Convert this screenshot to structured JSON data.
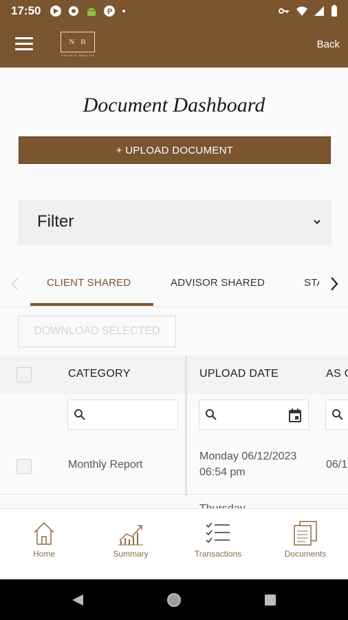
{
  "status_bar": {
    "time": "17:50"
  },
  "header": {
    "logo_letters": [
      "N",
      "B"
    ],
    "logo_subtext": "PRIVATE WEALTH",
    "back_label": "Back"
  },
  "page": {
    "title": "Document Dashboard",
    "upload_label": "+ UPLOAD DOCUMENT",
    "filter_label": "Filter"
  },
  "tabs": [
    {
      "label": "CLIENT SHARED",
      "active": true
    },
    {
      "label": "ADVISOR SHARED",
      "active": false
    },
    {
      "label": "STA",
      "active": false
    }
  ],
  "download_label": "DOWNLOAD SELECTED",
  "table": {
    "columns": [
      "CATEGORY",
      "UPLOAD DATE",
      "AS O"
    ],
    "rows": [
      {
        "category": "Monthly Report",
        "upload_date_line1": "Monday 06/12/2023",
        "upload_date_line2": "06:54 pm",
        "as_of": "06/1"
      },
      {
        "category": "",
        "upload_date_line1": "Thursday",
        "upload_date_line2": "",
        "as_of": ""
      }
    ]
  },
  "bottom_nav": [
    {
      "label": "Home",
      "icon": "home-icon"
    },
    {
      "label": "Summary",
      "icon": "chart-icon"
    },
    {
      "label": "Transactions",
      "icon": "list-icon"
    },
    {
      "label": "Documents",
      "icon": "documents-icon"
    }
  ],
  "colors": {
    "brand": "#7b5530",
    "nav_label": "#8c6a45"
  }
}
